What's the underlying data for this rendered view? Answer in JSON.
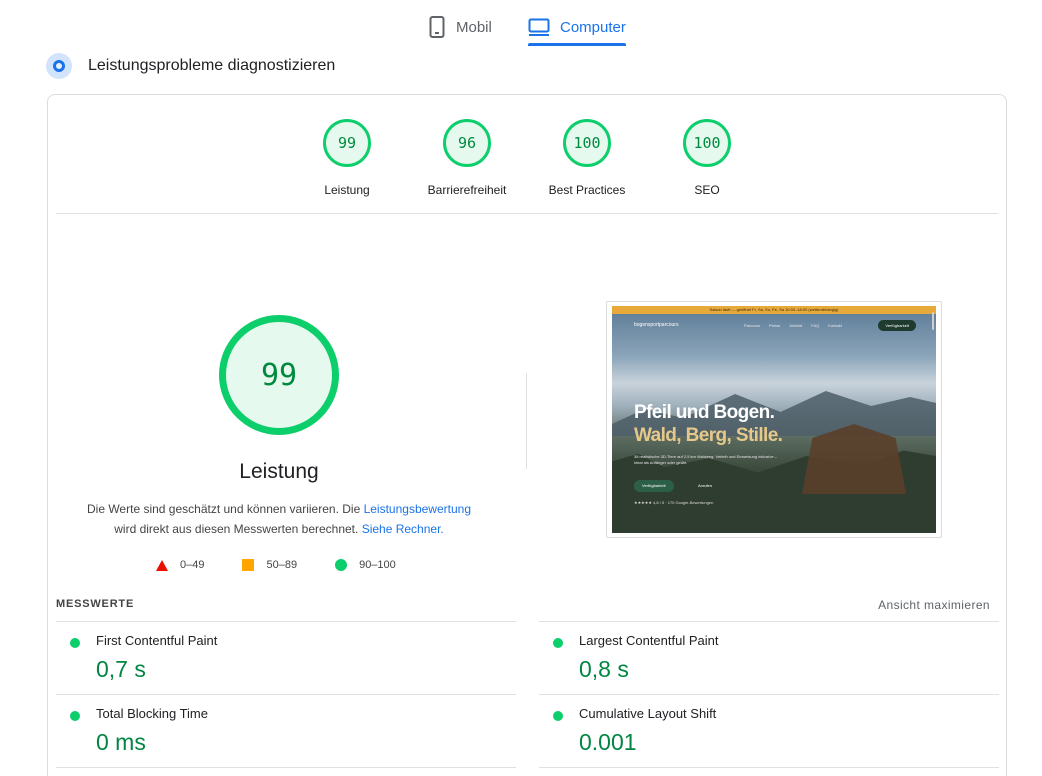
{
  "tabs": [
    {
      "label": "Mobil",
      "icon": "smartphone-icon",
      "active": false
    },
    {
      "label": "Computer",
      "icon": "desktop-icon",
      "active": true
    }
  ],
  "diagnose": {
    "title": "Leistungsprobleme diagnostizieren"
  },
  "categories": [
    {
      "score": "99",
      "label": "Leistung"
    },
    {
      "score": "96",
      "label": "Barrierefreiheit"
    },
    {
      "score": "100",
      "label": "Best Practices"
    },
    {
      "score": "100",
      "label": "SEO"
    }
  ],
  "performance": {
    "score": "99",
    "label": "Leistung",
    "desc_text1": "Die Werte sind geschätzt und können variieren. Die ",
    "desc_link1": "Leistungsbewertung",
    "desc_text2": "wird direkt aus diesen Messwerten berechnet. ",
    "desc_link2": "Siehe Rechner."
  },
  "legend": [
    {
      "range": "0–49",
      "shape": "triangle",
      "color": "#eb0f00"
    },
    {
      "range": "50–89",
      "shape": "square",
      "color": "#ffa400"
    },
    {
      "range": "90–100",
      "shape": "circle",
      "color": "#0cce6b"
    }
  ],
  "screenshot": {
    "banner": "Saison läuft — geöffnet Fr, Sa, So, Fe, Sa 10:00–18:00 (wetterabhängig)",
    "logo": "bogensportparcours",
    "nav_links": [
      "Parcours",
      "Preise",
      "Anfahrt",
      "FAQ",
      "Kontakt"
    ],
    "cta": "Verfügbarkeit",
    "title_line1": "Pfeil und Bogen.",
    "title_line2": "Wald, Berg, Stille.",
    "subtitle": "38 realistische 3D-Tiere auf 2,5 km Waldweg. Verleih und Einweisung inklusive – Ideal als Anfänger oder geübt.",
    "button1": "Verfügbarkeit",
    "button2": "Anrufen",
    "rating": "★★★★★ 4,8 / 5 · 170 Google-Bewertungen"
  },
  "metrics_header": {
    "label": "MESSWERTE",
    "expand": "Ansicht maximieren"
  },
  "metrics": [
    {
      "name": "First Contentful Paint",
      "value": "0,7 s"
    },
    {
      "name": "Largest Contentful Paint",
      "value": "0,8 s"
    },
    {
      "name": "Total Blocking Time",
      "value": "0 ms"
    },
    {
      "name": "Cumulative Layout Shift",
      "value": "0.001"
    }
  ],
  "colors": {
    "accent": "#1a73e8",
    "pass": "#0cce6b",
    "pass_text": "#018642",
    "average": "#ffa400",
    "fail": "#eb0f00"
  }
}
